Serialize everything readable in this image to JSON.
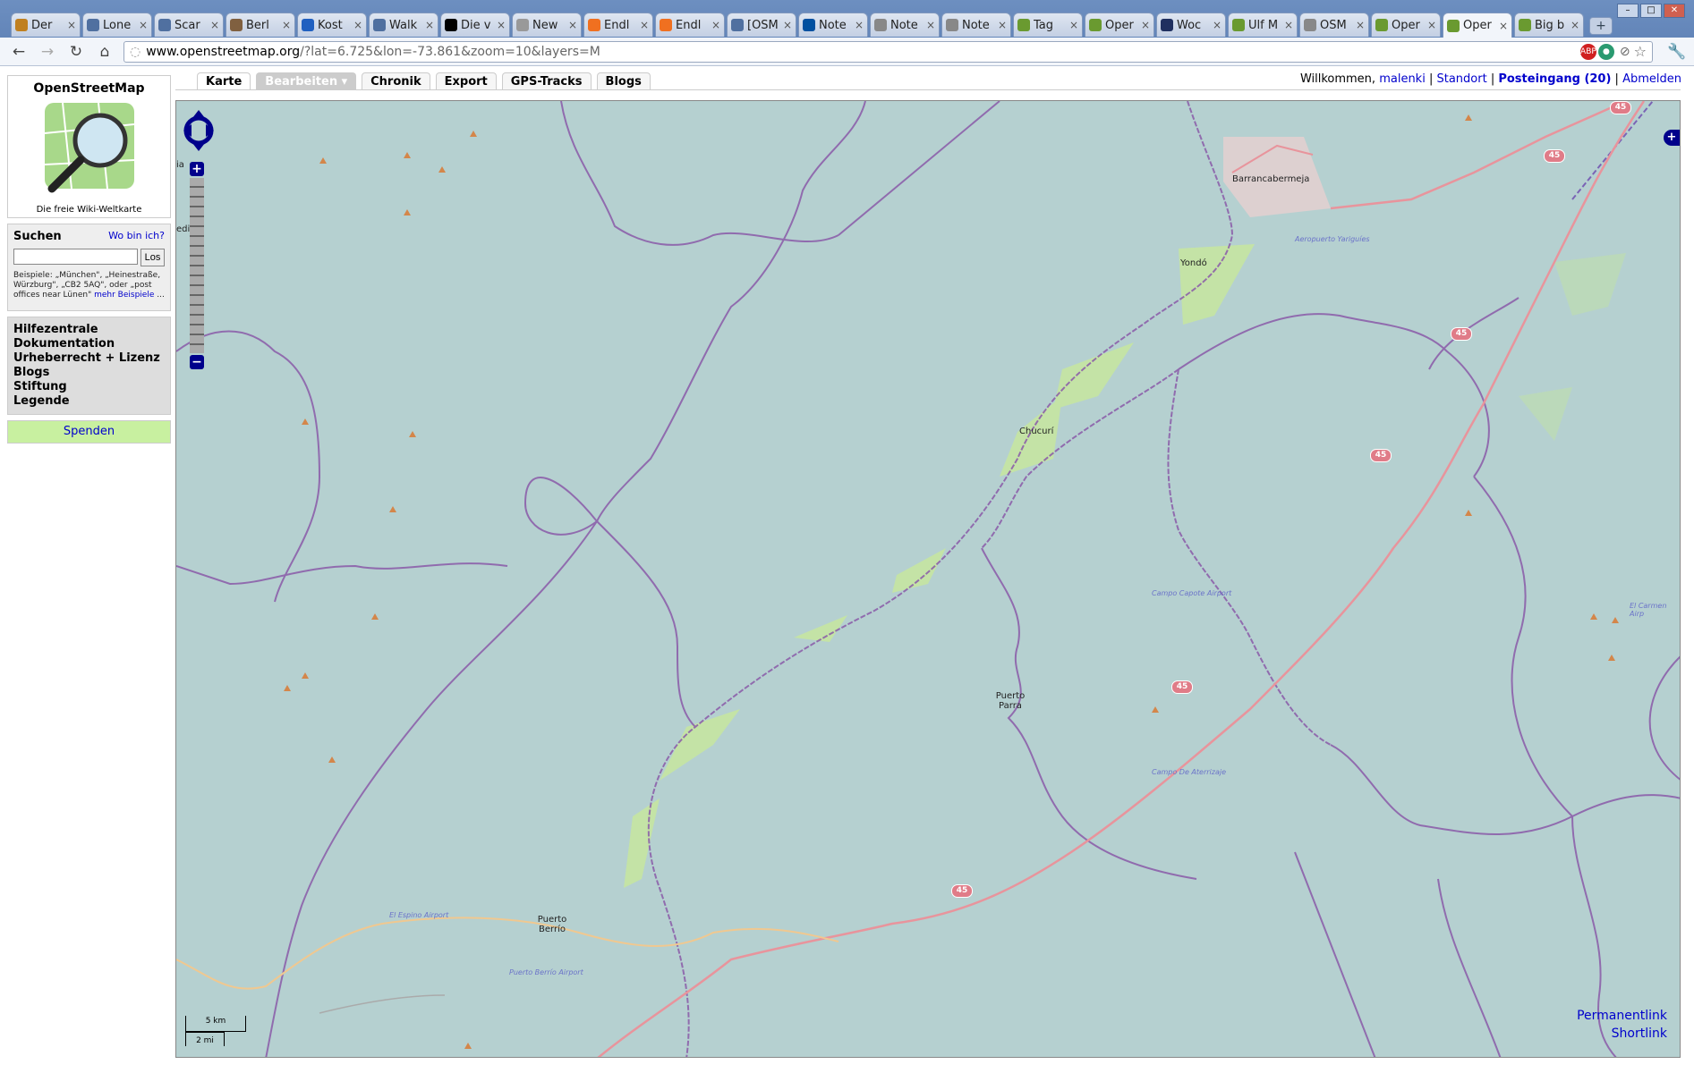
{
  "browser": {
    "tabs": [
      {
        "label": "Der",
        "icon": "abc-icon",
        "color": "#c08020"
      },
      {
        "label": "Lone",
        "icon": "globe-icon",
        "color": "#5070a0"
      },
      {
        "label": "Scar",
        "icon": "globe-icon",
        "color": "#5070a0"
      },
      {
        "label": "Berl",
        "icon": "building-icon",
        "color": "#806040"
      },
      {
        "label": "Kost",
        "icon": "building-icon",
        "color": "#2060c0"
      },
      {
        "label": "Walk",
        "icon": "globe-icon",
        "color": "#5070a0"
      },
      {
        "label": "Die v",
        "icon": "amazon-icon",
        "color": "#000"
      },
      {
        "label": "New",
        "icon": "spinner-icon",
        "color": "#999"
      },
      {
        "label": "Endl",
        "icon": "blogger-icon",
        "color": "#f07020"
      },
      {
        "label": "Endl",
        "icon": "blogger-icon",
        "color": "#f07020"
      },
      {
        "label": "[OSM",
        "icon": "globe-icon",
        "color": "#5070a0"
      },
      {
        "label": "Note",
        "icon": "cp-icon",
        "color": "#0050a0"
      },
      {
        "label": "Note",
        "icon": "at-icon",
        "color": "#888"
      },
      {
        "label": "Note",
        "icon": "at-icon",
        "color": "#888"
      },
      {
        "label": "Tag",
        "icon": "osm-icon",
        "color": "#6a9a30"
      },
      {
        "label": "Oper",
        "icon": "osm-icon",
        "color": "#6a9a30"
      },
      {
        "label": "Woc",
        "icon": "o-icon",
        "color": "#203060"
      },
      {
        "label": "Ulf M",
        "icon": "osm-icon",
        "color": "#6a9a30"
      },
      {
        "label": "OSM",
        "icon": "search-icon",
        "color": "#888"
      },
      {
        "label": "Oper",
        "icon": "osm-icon",
        "color": "#6a9a30"
      },
      {
        "label": "Oper",
        "icon": "osm-icon",
        "color": "#6a9a30",
        "active": true
      },
      {
        "label": "Big b",
        "icon": "osm-icon",
        "color": "#6a9a30"
      }
    ],
    "url_domain": "www.openstreetmap.org",
    "url_rest": "/?lat=6.725&lon=-73.861&zoom=10&layers=M"
  },
  "sidebar": {
    "site_title": "OpenStreetMap",
    "tagline": "Die freie Wiki-Weltkarte",
    "search_heading": "Suchen",
    "where_am_i": "Wo bin ich?",
    "search_value": "",
    "search_button": "Los",
    "examples": "Beispiele: „München\", „Heinestraße, Würzburg\", „CB2 5AQ\", oder „post offices near Lünen\"",
    "more_examples": "mehr Beispiele",
    "links": [
      "Hilfezentrale",
      "Dokumentation",
      "Urheberrecht + Lizenz",
      "Blogs",
      "Stiftung",
      "Legende"
    ],
    "donate": "Spenden"
  },
  "nav_tabs": [
    {
      "label": "Karte",
      "state": "selected"
    },
    {
      "label": "Bearbeiten ▾",
      "state": "disabled"
    },
    {
      "label": "Chronik",
      "state": "normal"
    },
    {
      "label": "Export",
      "state": "normal"
    },
    {
      "label": "GPS-Tracks",
      "state": "normal"
    },
    {
      "label": "Blogs",
      "state": "normal"
    }
  ],
  "user": {
    "welcome": "Willkommen,",
    "name": "malenki",
    "location": "Standort",
    "inbox": "Posteingang (20)",
    "logout": "Abmelden"
  },
  "map": {
    "places": [
      {
        "name": "Barrancabermeja"
      },
      {
        "name": "Yondó"
      },
      {
        "name": "Chucurí"
      },
      {
        "name": "Puerto Parra"
      },
      {
        "name": "Puerto Berrío"
      }
    ],
    "airports": [
      "Aeropuerto Yariguíes",
      "Campo Capote Airport",
      "Campo De Aterrizaje",
      "El Espino Airport",
      "Puerto Berrío Airport",
      "El Carmen Airp"
    ],
    "route_number": "45",
    "scale_km": "5 km",
    "scale_mi": "2 mi",
    "permalink": "Permanentlink",
    "shortlink": "Shortlink",
    "edge_label_1": "ia",
    "edge_label_2": "edios"
  }
}
